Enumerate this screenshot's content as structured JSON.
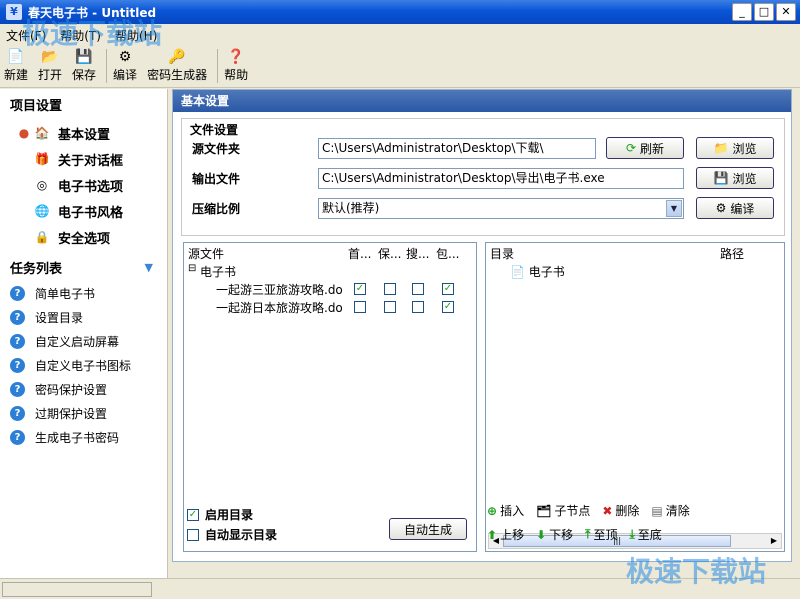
{
  "window": {
    "title": "春天电子书 - Untitled"
  },
  "menu": [
    "文件(F)",
    "帮助(T)",
    "帮助(H)"
  ],
  "toolbar": {
    "new": "新建",
    "open": "打开",
    "save": "保存",
    "compile": "编译",
    "password_gen": "密码生成器",
    "help": "帮助"
  },
  "sidebar": {
    "project_title": "项目设置",
    "project_items": [
      "基本设置",
      "关于对话框",
      "电子书选项",
      "电子书风格",
      "安全选项"
    ],
    "task_title": "任务列表",
    "task_items": [
      "简单电子书",
      "设置目录",
      "自定义启动屏幕",
      "自定义电子书图标",
      "密码保护设置",
      "过期保护设置",
      "生成电子书密码"
    ]
  },
  "main": {
    "panel_title": "基本设置",
    "file_settings": "文件设置",
    "source_label": "源文件夹",
    "source_value": "C:\\Users\\Administrator\\Desktop\\下载\\",
    "refresh": "刷新",
    "browse1": "浏览",
    "output_label": "输出文件",
    "output_value": "C:\\Users\\Administrator\\Desktop\\导出\\电子书.exe",
    "browse2": "浏览",
    "compress_label": "压缩比例",
    "compress_value": "默认(推荐)",
    "compile": "编译"
  },
  "source_list": {
    "headers": [
      "源文件",
      "首...",
      "保...",
      "搜...",
      "包..."
    ],
    "root": "电子书",
    "rows": [
      {
        "name": "一起游三亚旅游攻略.do",
        "checks": [
          true,
          false,
          false,
          true
        ]
      },
      {
        "name": "一起游日本旅游攻略.do",
        "checks": [
          false,
          false,
          false,
          true
        ]
      }
    ],
    "enable_toc": "启用目录",
    "auto_show_toc": "自动显示目录",
    "auto_generate": "自动生成"
  },
  "toc": {
    "headers": [
      "目录",
      "路径"
    ],
    "root": "电子书",
    "buttons": {
      "insert": "插入",
      "child": "子节点",
      "delete": "删除",
      "clear": "清除",
      "up": "上移",
      "down": "下移",
      "top": "至顶",
      "bottom": "至底"
    }
  },
  "watermark": "极速下载站"
}
